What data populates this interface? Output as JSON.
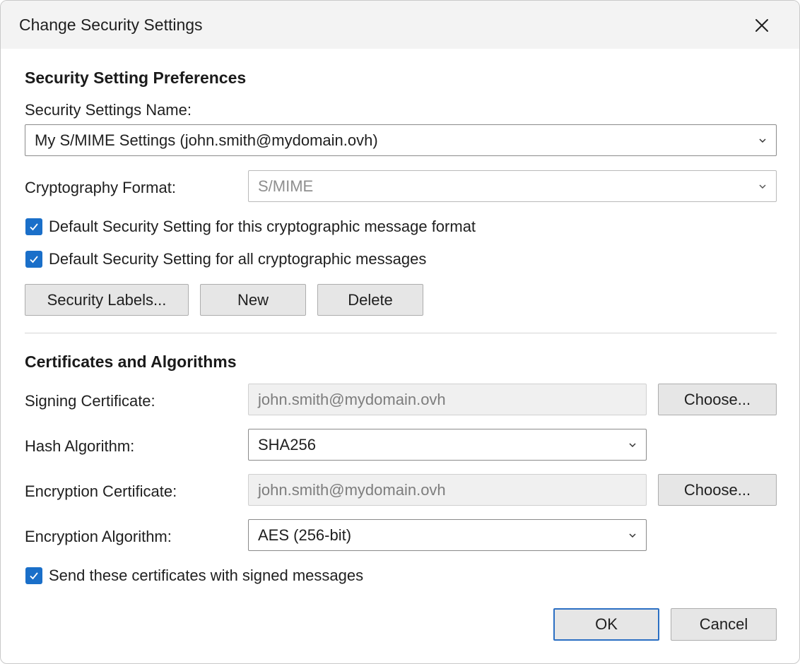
{
  "dialog": {
    "title": "Change Security Settings"
  },
  "preferences": {
    "section_title": "Security Setting Preferences",
    "name_label": "Security Settings Name:",
    "name_value": "My S/MIME Settings (john.smith@mydomain.ovh)",
    "format_label": "Cryptography Format:",
    "format_value": "S/MIME",
    "default_format_checkbox": {
      "label": "Default Security Setting for this cryptographic message format",
      "checked": true
    },
    "default_all_checkbox": {
      "label": "Default Security Setting for all cryptographic messages",
      "checked": true
    },
    "buttons": {
      "security_labels": "Security Labels...",
      "new": "New",
      "delete": "Delete"
    }
  },
  "certificates": {
    "section_title": "Certificates and Algorithms",
    "signing_label": "Signing Certificate:",
    "signing_value": "john.smith@mydomain.ovh",
    "signing_choose": "Choose...",
    "hash_label": "Hash Algorithm:",
    "hash_value": "SHA256",
    "encryption_cert_label": "Encryption Certificate:",
    "encryption_cert_value": "john.smith@mydomain.ovh",
    "encryption_choose": "Choose...",
    "encryption_algo_label": "Encryption Algorithm:",
    "encryption_algo_value": "AES (256-bit)",
    "send_certs_checkbox": {
      "label": "Send these certificates with signed messages",
      "checked": true
    }
  },
  "footer": {
    "ok": "OK",
    "cancel": "Cancel"
  },
  "colors": {
    "accent": "#1a6fc9",
    "primary_border": "#2b6fc3",
    "titlebar_bg": "#f3f3f3"
  },
  "icons": {
    "close": "close-icon",
    "dropdown": "chevron-down-icon",
    "check": "checkmark-icon"
  }
}
